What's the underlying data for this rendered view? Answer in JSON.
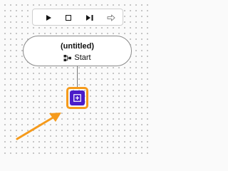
{
  "canvas": {
    "background": "#fafafa"
  },
  "toolbar": {
    "buttons": [
      {
        "name": "run-icon"
      },
      {
        "name": "stop-icon"
      },
      {
        "name": "step-icon"
      },
      {
        "name": "export-arrow-icon"
      }
    ]
  },
  "node": {
    "title": "(untitled)",
    "subtitle": "Start",
    "icon": "flow-icon"
  },
  "add_step": {
    "icon": "plus-box-icon",
    "fill_color": "#4a1cc9",
    "highlight_color": "#f59a1b"
  },
  "annotation": {
    "icon": "pointer-arrow-icon",
    "color": "#f59a1b"
  }
}
